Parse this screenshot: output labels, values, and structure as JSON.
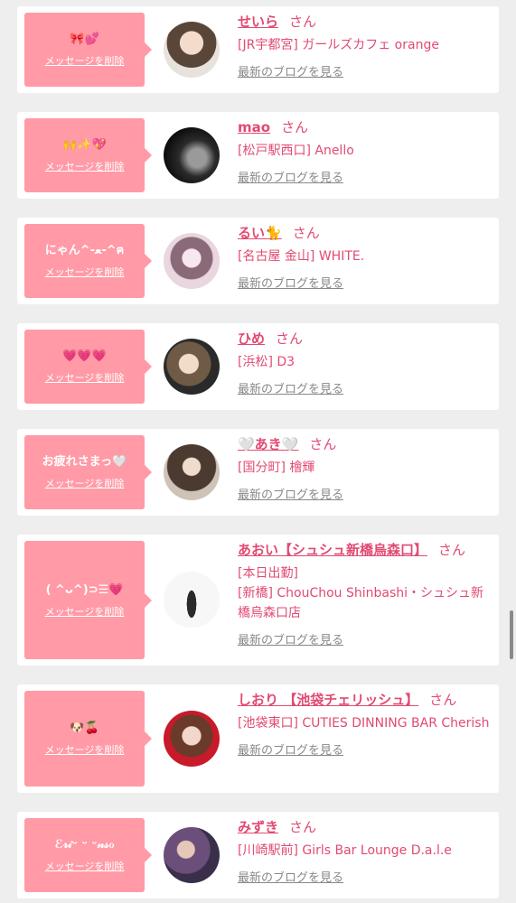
{
  "common": {
    "delete_label": "メッセージを削除",
    "honorific": "さん",
    "blog_label": "最新のブログを見る"
  },
  "colors": {
    "accent": "#e24a72",
    "bubble": "#ff9aa6",
    "page_bg": "#eeeeee"
  },
  "cards": [
    {
      "message": "🎀💕",
      "name": "せいら",
      "shop": "[JR宇都宮] ガールズカフェ orange"
    },
    {
      "message": "🙌✨💖",
      "name": "mao",
      "shop": "[松戸駅西口] Anello"
    },
    {
      "message": "にゃん^-ﻌ-^ฅ",
      "name": "るい🐈",
      "shop": "[名古屋 金山] WHITE."
    },
    {
      "message": "💗💗💗",
      "name": "ひめ",
      "shop": "[浜松] D3"
    },
    {
      "message": "お疲れさまっ🤍",
      "name": "🤍あき🤍",
      "shop": "[国分町] 檜輝"
    },
    {
      "message": "( ^ᴗ^)⊃☰💗",
      "name": "あおい【シュシュ新橋烏森口】",
      "shop": "[本日出勤]",
      "shop2": "[新橋] ChouChou Shinbashi・シュシュ新橋烏森口店"
    },
    {
      "message": "🐶🍒",
      "name": "しおり 【池袋チェリッシュ】",
      "shop": "[池袋東口] CUTIES DINNING BAR Cherish"
    },
    {
      "message": "ℰ𝓇𝒾ᵕ ᵕ ᵕ𝓃𝓈ℴ",
      "name": "みずき",
      "shop": "[川崎駅前] Girls Bar Lounge D.a.l.e"
    }
  ]
}
